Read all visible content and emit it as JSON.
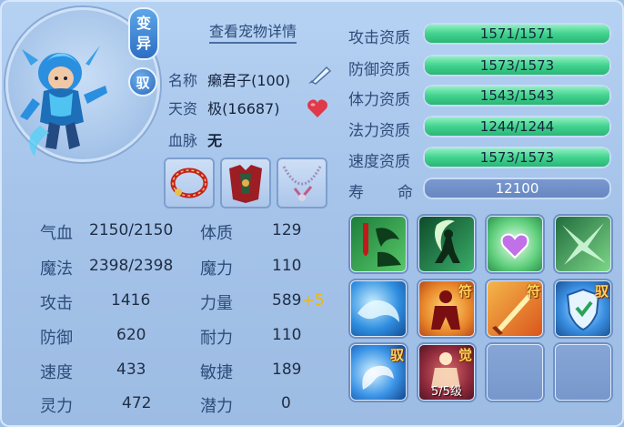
{
  "detail_link": "查看宠物详情",
  "badges": {
    "mutation": [
      "变",
      "异"
    ],
    "tamed": "驭"
  },
  "info": {
    "name_label": "名称",
    "name_value": "癞君子(100)",
    "talent_label": "天资",
    "talent_value": "极(16687)",
    "bloodline_label": "血脉",
    "bloodline_value": "无"
  },
  "equipment": [
    {
      "icon": "red-necklace-icon"
    },
    {
      "icon": "red-armor-icon"
    },
    {
      "icon": "purple-necklace-icon"
    }
  ],
  "stats": [
    {
      "label": "气血",
      "value": "2150/2150",
      "attr_label": "体质",
      "attr_value": "129",
      "bonus": ""
    },
    {
      "label": "魔法",
      "value": "2398/2398",
      "attr_label": "魔力",
      "attr_value": "110",
      "bonus": ""
    },
    {
      "label": "攻击",
      "value": "1416",
      "attr_label": "力量",
      "attr_value": "589",
      "bonus": "+5"
    },
    {
      "label": "防御",
      "value": "620",
      "attr_label": "耐力",
      "attr_value": "110",
      "bonus": ""
    },
    {
      "label": "速度",
      "value": "433",
      "attr_label": "敏捷",
      "attr_value": "189",
      "bonus": ""
    },
    {
      "label": "灵力",
      "value": "472",
      "attr_label": "潜力",
      "attr_value": "0",
      "bonus": ""
    }
  ],
  "qualifications": [
    {
      "label": "攻击资质",
      "value": "1571/1571",
      "fill": 1.0
    },
    {
      "label": "防御资质",
      "value": "1573/1573",
      "fill": 1.0
    },
    {
      "label": "体力资质",
      "value": "1543/1543",
      "fill": 1.0
    },
    {
      "label": "法力资质",
      "value": "1244/1244",
      "fill": 1.0
    },
    {
      "label": "速度资质",
      "value": "1573/1573",
      "fill": 1.0
    }
  ],
  "lifespan": {
    "label_a": "寿",
    "label_b": "命",
    "value": "12100"
  },
  "skills": [
    {
      "icon": "blood-drain-skill-icon",
      "tag": "",
      "level": ""
    },
    {
      "icon": "night-warrior-skill-icon",
      "tag": "",
      "level": ""
    },
    {
      "icon": "heart-shield-skill-icon",
      "tag": "",
      "level": ""
    },
    {
      "icon": "green-shatter-skill-icon",
      "tag": "",
      "level": ""
    },
    {
      "icon": "water-wave-skill-icon",
      "tag": "",
      "level": ""
    },
    {
      "icon": "rage-figure-skill-icon",
      "tag": "符",
      "level": ""
    },
    {
      "icon": "fire-sword-skill-icon",
      "tag": "符",
      "level": ""
    },
    {
      "icon": "blue-shield-skill-icon",
      "tag": "驭",
      "level": ""
    },
    {
      "icon": "ice-vortex-skill-icon",
      "tag": "驭",
      "level": ""
    },
    {
      "icon": "awaken-warrior-skill-icon",
      "tag": "觉",
      "level": "5/5级"
    },
    {
      "icon": "empty-slot",
      "tag": "",
      "level": ""
    },
    {
      "icon": "empty-slot",
      "tag": "",
      "level": ""
    }
  ]
}
